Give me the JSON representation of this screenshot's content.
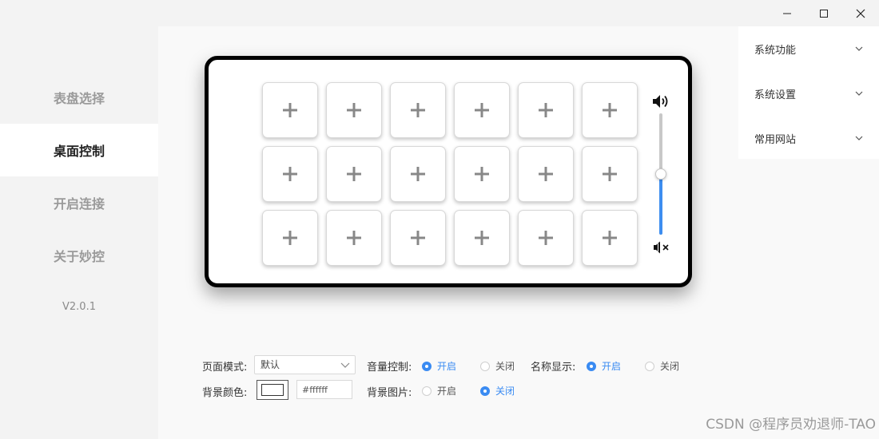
{
  "window": {
    "controls": [
      "minimize-icon",
      "maximize-icon",
      "close-icon"
    ]
  },
  "sidebar": {
    "items": [
      {
        "label": "表盘选择",
        "active": false
      },
      {
        "label": "桌面控制",
        "active": true
      },
      {
        "label": "开启连接",
        "active": false
      },
      {
        "label": "关于妙控",
        "active": false
      }
    ],
    "version": "V2.0.1"
  },
  "device": {
    "rows": 3,
    "columns": 6,
    "key_icon": "plus-icon",
    "volume": {
      "level": 0.5,
      "max_icon": "volume-icon",
      "min_icon": "mute-icon",
      "accent": "#3d8ef0"
    }
  },
  "settings": {
    "page_mode": {
      "label": "页面模式:",
      "value": "默认"
    },
    "volume_control": {
      "label": "音量控制:",
      "on": "开启",
      "off": "关闭",
      "selected": "on"
    },
    "name_display": {
      "label": "名称显示:",
      "on": "开启",
      "off": "关闭",
      "selected": "on"
    },
    "bg_color": {
      "label": "背景颜色:",
      "value": "#ffffff"
    },
    "bg_image": {
      "label": "背景图片:",
      "on": "开启",
      "off": "关闭",
      "selected": "off"
    }
  },
  "right_menu": {
    "items": [
      {
        "label": "系统功能"
      },
      {
        "label": "系统设置"
      },
      {
        "label": "常用网站"
      }
    ]
  },
  "watermark": "CSDN @程序员劝退师-TAO",
  "colors": {
    "accent": "#3a8bf2",
    "active_nav_text": "#222222",
    "inactive_nav_text": "#9a9a9a"
  }
}
